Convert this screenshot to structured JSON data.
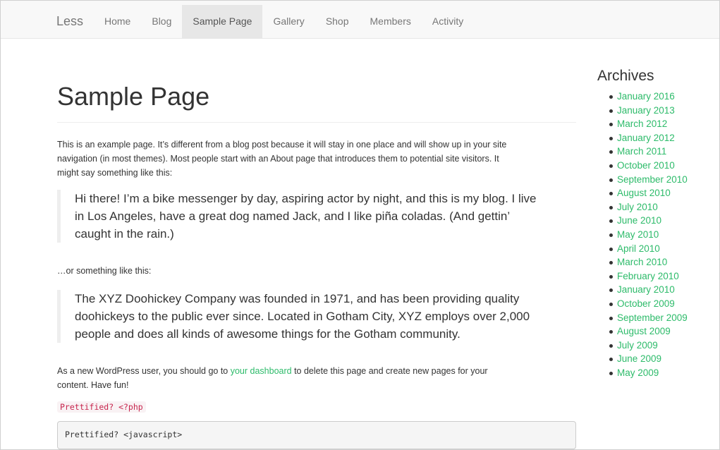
{
  "navbar": {
    "brand": "Less",
    "items": [
      {
        "label": "Home",
        "active": false
      },
      {
        "label": "Blog",
        "active": false
      },
      {
        "label": "Sample Page",
        "active": true
      },
      {
        "label": "Gallery",
        "active": false
      },
      {
        "label": "Shop",
        "active": false
      },
      {
        "label": "Members",
        "active": false
      },
      {
        "label": "Activity",
        "active": false
      }
    ]
  },
  "main": {
    "title": "Sample Page",
    "intro_line1": "This is an example page. It’s different from a blog post because it will stay in one place and will show up in your site",
    "intro_line2": "navigation (in most themes). Most people start with an About page that introduces them to potential site visitors. It",
    "intro_line3": "might say something like this:",
    "quote1_line1": "Hi there! I’m a bike messenger by day, aspiring actor by night, and this is my blog. I live",
    "quote1_line2": "in Los Angeles, have a great dog named Jack, and I like piña coladas. (And gettin’",
    "quote1_line3": "caught in the rain.)",
    "or_text": "…or something like this:",
    "quote2_line1": "The XYZ Doohickey Company was founded in 1971, and has been providing quality",
    "quote2_line2": "doohickeys to the public ever since. Located in Gotham City, XYZ employs over 2,000",
    "quote2_line3": "people and does all kinds of awesome things for the Gotham community.",
    "outro_before": "As a new WordPress user, you should go to ",
    "outro_link": "your dashboard",
    "outro_after": " to delete this page and create new pages for your",
    "outro_line2": "content. Have fun!",
    "inline_code": "Prettified? <?php",
    "code_block": "Prettified? <javascript>"
  },
  "sidebar": {
    "title": "Archives",
    "items": [
      "January 2016",
      "January 2013",
      "March 2012",
      "January 2012",
      "March 2011",
      "October 2010",
      "September 2010",
      "August 2010",
      "July 2010",
      "June 2010",
      "May 2010",
      "April 2010",
      "March 2010",
      "February 2010",
      "January 2010",
      "October 2009",
      "September 2009",
      "August 2009",
      "July 2009",
      "June 2009",
      "May 2009"
    ]
  },
  "colors": {
    "link": "#2dbb6a",
    "navbar_bg": "#f8f8f8",
    "nav_active_bg": "#e7e7e7",
    "code_text": "#c7254e"
  }
}
